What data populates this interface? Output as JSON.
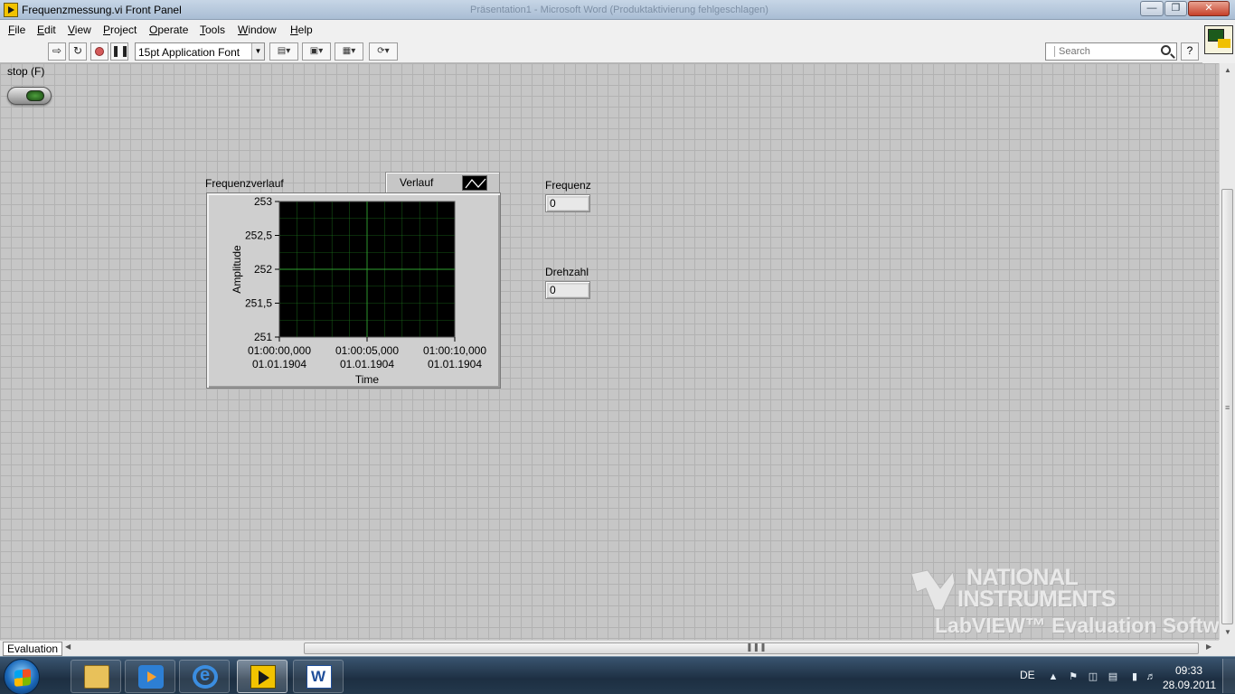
{
  "window": {
    "title": "Frequenzmessung.vi Front Panel",
    "background_title": "Präsentation1 - Microsoft Word (Produktaktivierung fehlgeschlagen)"
  },
  "menu": {
    "items": [
      "File",
      "Edit",
      "View",
      "Project",
      "Operate",
      "Tools",
      "Window",
      "Help"
    ]
  },
  "toolbar": {
    "font": "15pt Application Font",
    "search_placeholder": "Search",
    "help": "?"
  },
  "panel": {
    "stop_label": "stop (F)",
    "graph": {
      "label": "Frequenzverlauf",
      "legend_name": "Verlauf"
    },
    "indicators": [
      {
        "label": "Frequenz",
        "value": "0"
      },
      {
        "label": "Drehzahl",
        "value": "0"
      }
    ],
    "watermark": {
      "line1": "NATIONAL",
      "line2": "INSTRUMENTS",
      "line3": "LabVIEW™ Evaluation Software"
    }
  },
  "chart_data": {
    "type": "line",
    "xlabel": "Time",
    "ylabel": "Amplitude",
    "ylim": [
      251,
      253
    ],
    "y_ticks": [
      "253",
      "252,5",
      "252",
      "251,5",
      "251"
    ],
    "x_ticks": [
      {
        "time": "01:00:00,000",
        "date": "01.01.1904"
      },
      {
        "time": "01:00:05,000",
        "date": "01.01.1904"
      },
      {
        "time": "01:00:10,000",
        "date": "01.01.1904"
      }
    ],
    "series": [
      {
        "values": []
      }
    ],
    "grid": true,
    "plot_color": "#000000",
    "grid_color": "#1e7a1e"
  },
  "statusbar": {
    "context": "Evaluation"
  },
  "taskbar": {
    "language": "DE",
    "time": "09:33",
    "date": "28.09.2011",
    "apps": [
      "folder-icon",
      "media-player-icon",
      "internet-explorer-icon",
      "labview-icon",
      "word-icon"
    ]
  }
}
